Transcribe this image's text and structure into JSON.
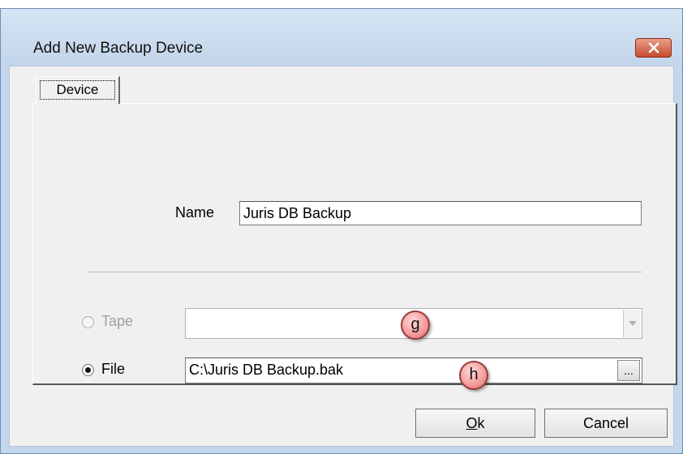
{
  "window": {
    "title": "Add New Backup Device",
    "close_icon": "close-x-icon"
  },
  "tabs": [
    {
      "label": "Device",
      "selected": true
    }
  ],
  "form": {
    "name_label": "Name",
    "name_value": "Juris DB Backup",
    "tape_label": "Tape",
    "tape_value": "",
    "tape_enabled": false,
    "file_label": "File",
    "file_value": "C:\\Juris DB Backup.bak",
    "file_selected": true,
    "browse_label": "..."
  },
  "callouts": {
    "g": "g",
    "h": "h"
  },
  "buttons": {
    "ok_prefix": "O",
    "ok_suffix": "k",
    "cancel": "Cancel"
  }
}
